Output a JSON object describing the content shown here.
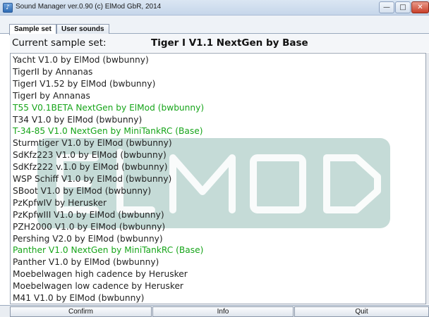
{
  "window": {
    "title": "Sound Manager ver.0.90 (c) ElMod GbR, 2014",
    "controls": {
      "minimize": "—",
      "maximize": "□",
      "close": "✕"
    }
  },
  "tabs": [
    {
      "label": "Sample set",
      "active": true
    },
    {
      "label": "User sounds",
      "active": false
    }
  ],
  "current": {
    "label": "Current sample set:",
    "value": "Tiger I V1.1 NextGen by Base"
  },
  "list": {
    "items": [
      {
        "label": "Yacht V1.0 by ElMod (bwbunny)",
        "color": "#222222"
      },
      {
        "label": "TigerII  by Annanas",
        "color": "#222222"
      },
      {
        "label": "TigerI V1.52 by ElMod (bwbunny)",
        "color": "#222222"
      },
      {
        "label": "TigerI  by Annanas",
        "color": "#222222"
      },
      {
        "label": "T55 V0.1BETA NextGen by ElMod (bwbunny)",
        "color": "#17a51a"
      },
      {
        "label": "T34 V1.0 by ElMod (bwbunny)",
        "color": "#222222"
      },
      {
        "label": "T-34-85 V1.0 NextGen by MiniTankRC (Base)",
        "color": "#17a51a"
      },
      {
        "label": "Sturmtiger V1.0 by ElMod (bwbunny)",
        "color": "#222222"
      },
      {
        "label": "SdKfz223 V1.0 by ElMod (bwbunny)",
        "color": "#222222"
      },
      {
        "label": "SdKfz222 v.1.0 by ElMod (bwbunny)",
        "color": "#222222"
      },
      {
        "label": "WSP Schiff V1.0 by ElMod (bwbunny)",
        "color": "#222222"
      },
      {
        "label": "SBoot V1.0 by ElMod (bwbunny)",
        "color": "#222222"
      },
      {
        "label": "PzKpfwIV  by Herusker",
        "color": "#222222"
      },
      {
        "label": "PzKpfwIII V1.0 by ElMod (bwbunny)",
        "color": "#222222"
      },
      {
        "label": "PZH2000 V1.0 by ElMod (bwbunny)",
        "color": "#222222"
      },
      {
        "label": "Pershing V2.0 by ElMod (bwbunny)",
        "color": "#222222"
      },
      {
        "label": "Panther V1.0 NextGen by MiniTankRC (Base)",
        "color": "#17a51a"
      },
      {
        "label": "Panther V1.0 by ElMod (bwbunny)",
        "color": "#222222"
      },
      {
        "label": "Moebelwagen high cadence by Herusker",
        "color": "#222222"
      },
      {
        "label": "Moebelwagen low cadence by Herusker",
        "color": "#222222"
      },
      {
        "label": "M41 V1.0 by ElMod (bwbunny)",
        "color": "#222222"
      }
    ]
  },
  "buttons": {
    "confirm": "Confirm",
    "info": "Info",
    "quit": "Quit"
  },
  "colors": {
    "accent_green": "#17a51a",
    "watermark": "#7fb0a6"
  }
}
